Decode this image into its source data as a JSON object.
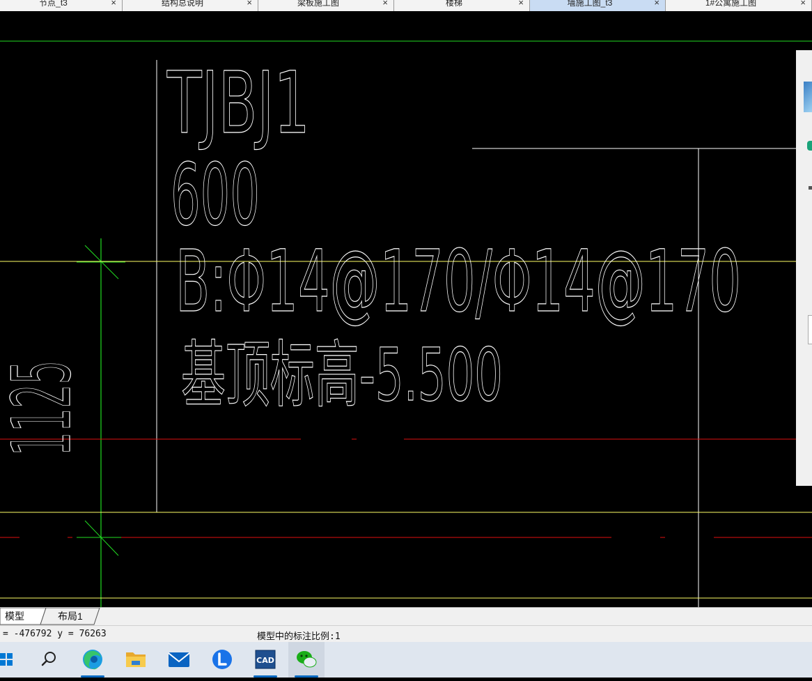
{
  "tabs": [
    {
      "label": "节点_t3",
      "close": "×",
      "active": false
    },
    {
      "label": "结构总说明",
      "close": "×",
      "active": false
    },
    {
      "label": "梁板施工图",
      "close": "×",
      "active": false
    },
    {
      "label": "楼梯",
      "close": "×",
      "active": false
    },
    {
      "label": "墙施工图_t3",
      "close": "×",
      "active": true
    },
    {
      "label": "1#公寓施工图",
      "close": "×",
      "active": false
    }
  ],
  "drawing": {
    "title": "TJBJ1",
    "width": "600",
    "rebar": "B:Φ14@170/Φ14@170",
    "elevation": "基顶标高-5.500",
    "dimension": "1125"
  },
  "layout_tabs": [
    "模型",
    "布局1"
  ],
  "status": {
    "coords": "= -476792 y = 76263",
    "annotation_scale": "模型中的标注比例:1"
  },
  "taskbar": {
    "items": [
      "start-icon",
      "search-icon",
      "edge-icon",
      "file-explorer-icon",
      "mail-icon",
      "l-app-icon",
      "cad-icon",
      "wechat-icon"
    ],
    "cad_label": "CAD"
  },
  "colors": {
    "canvas": "#000000",
    "drawing_text": "#ffffff",
    "grid_yellow": "#ffff66",
    "axis_green": "#22dd22",
    "red_line": "#e01010",
    "active_tab": "#c9dcf3"
  }
}
